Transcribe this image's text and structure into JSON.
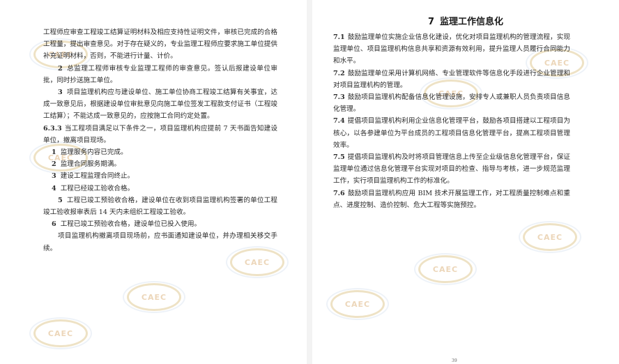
{
  "left_page": {
    "paragraphs": [
      {
        "style": "plain",
        "text": "工程师应审查工程竣工结算证明材料及相应支持性证明文件，审核已完成的合格工程量，提出审查意见。对于存在疑义的，专业监理工程师应要求施工单位提供补充证明材料，否则，不能进行计量、计价。"
      },
      {
        "style": "ind",
        "num": "2",
        "text": "总监理工程师审核专业监理工程师的审查意见。签认后报建设单位审批，同时抄送施工单位。"
      },
      {
        "style": "ind",
        "num": "3",
        "text": "项目监理机构应与建设单位、施工单位协商工程竣工结算有关事宜，达成一致意见后，根据建设单位审批意见向施工单位签发工程款支付证书（工程竣工结算）；不能达成一致意见的，应按施工合同约定处置。"
      },
      {
        "style": "plain",
        "label": "6.3.3",
        "text": "当工程项目满足以下条件之一，项目监理机构应提前 7 天书面告知建设单位，撤离项目现场。"
      },
      {
        "style": "item",
        "num": "1",
        "text": "监理服务内容已完成。"
      },
      {
        "style": "item",
        "num": "2",
        "text": "监理合同服务期满。"
      },
      {
        "style": "item",
        "num": "3",
        "text": "建设工程监理合同终止。"
      },
      {
        "style": "item",
        "num": "4",
        "text": "工程已经竣工验收合格。"
      },
      {
        "style": "ind",
        "num": "5",
        "text": "工程已竣工预验收合格，建设单位在收到项目监理机构签署的单位工程竣工验收报审表后 14 天内未组织工程竣工验收。"
      },
      {
        "style": "item",
        "num": "6",
        "text": "工程已竣工预验收合格，建设单位已投入使用。"
      },
      {
        "style": "ind",
        "text": "项目监理机构撤离项目现场前，应书面通知建设单位，并办理相关移交手续。"
      }
    ]
  },
  "right_page": {
    "chapter_number": "7",
    "chapter_title": "监理工作信息化",
    "paragraphs": [
      {
        "label": "7.1",
        "text": "鼓励监理单位实施企业信息化建设，优化对项目监理机构的管理流程，实现监理单位、项目监理机构信息共享和资源有效利用，提升监理人员履行合同能力和水平。"
      },
      {
        "label": "7.2",
        "text": "鼓励监理单位采用计算机网络、专业管理软件等信息化手段进行企业管理和对项目监理机构的管理。"
      },
      {
        "label": "7.3",
        "text": "鼓励项目监理机构配备信息化管理设施，安排专人或兼职人员负责项目信息化管理。"
      },
      {
        "label": "7.4",
        "text": "提倡项目监理机构利用企业信息化管理平台，鼓励各项目搭建以工程项目为核心，以各参建单位为平台成员的工程项目信息化管理平台，提高工程项目管理效率。"
      },
      {
        "label": "7.5",
        "text": "提倡项目监理机构及时将项目管理信息上传至企业级信息化管理平台，保证监理单位通过信息化管理平台实现对项目的检查、指导与考核，进一步规范监理工作，实行项目监理机构工作的标准化。"
      },
      {
        "label": "7.6",
        "text": "鼓励项目监理机构应用 BIM 技术开展监理工作，对工程质量控制难点和重点、进度控制、造价控制、危大工程等实施预控。"
      }
    ],
    "page_number": "39"
  },
  "watermark": {
    "text": "CAEC",
    "ring_color": "#e9d9b2",
    "outer_ring_color": "#e8eef6",
    "text_color": "#e6c9a2"
  }
}
